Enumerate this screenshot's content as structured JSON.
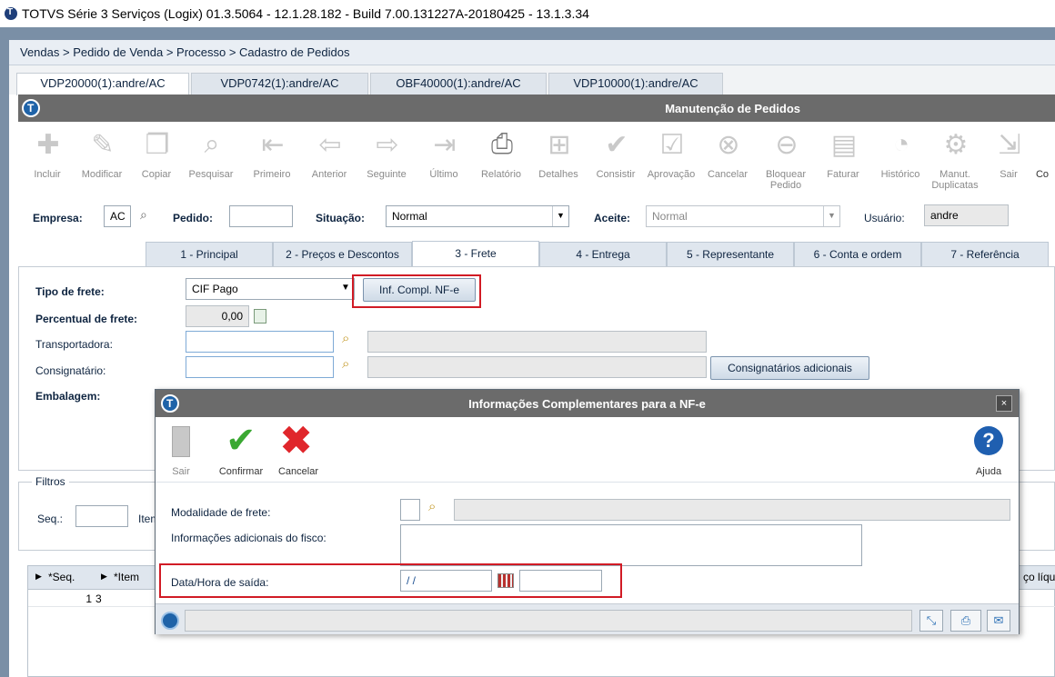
{
  "window": {
    "title": "TOTVS Série 3 Serviços (Logix) 01.3.5064  -  12.1.28.182 - Build 7.00.131227A-20180425 - 13.1.3.34"
  },
  "breadcrumb": "Vendas > Pedido de Venda > Processo > Cadastro de Pedidos",
  "main_tabs": [
    {
      "label": "VDP20000(1):andre/AC"
    },
    {
      "label": "VDP0742(1):andre/AC"
    },
    {
      "label": "OBF40000(1):andre/AC"
    },
    {
      "label": "VDP10000(1):andre/AC"
    }
  ],
  "app_title": "Manutenção de Pedidos",
  "toolbar": [
    {
      "label": "Incluir",
      "icon": "add-icon"
    },
    {
      "label": "Modificar",
      "icon": "edit-icon"
    },
    {
      "label": "Copiar",
      "icon": "copy-icon"
    },
    {
      "label": "Pesquisar",
      "icon": "search-icon"
    },
    {
      "label": "Primeiro",
      "icon": "first-icon"
    },
    {
      "label": "Anterior",
      "icon": "previous-icon"
    },
    {
      "label": "Seguinte",
      "icon": "next-icon"
    },
    {
      "label": "Último",
      "icon": "last-icon"
    },
    {
      "label": "Relatório",
      "icon": "print-icon"
    },
    {
      "label": "Detalhes",
      "icon": "details-icon"
    },
    {
      "label": "Consistir",
      "icon": "check-icon"
    },
    {
      "label": "Aprovação",
      "icon": "approval-icon"
    },
    {
      "label": "Cancelar",
      "icon": "cancel-icon"
    },
    {
      "label": "Bloquear Pedido",
      "icon": "block-icon"
    },
    {
      "label": "Faturar",
      "icon": "invoice-icon"
    },
    {
      "label": "Histórico",
      "icon": "history-icon"
    },
    {
      "label": "Manut. Duplicatas",
      "icon": "duplicates-icon"
    },
    {
      "label": "Sair",
      "icon": "exit-icon"
    },
    {
      "label": "Co",
      "icon": "more-icon"
    }
  ],
  "header": {
    "empresa_label": "Empresa:",
    "empresa_value": "AC",
    "pedido_label": "Pedido:",
    "pedido_value": "",
    "situacao_label": "Situação:",
    "situacao_value": "Normal",
    "aceite_label": "Aceite:",
    "aceite_value": "Normal",
    "usuario_label": "Usuário:",
    "usuario_value": "andre"
  },
  "sub_tabs": [
    {
      "label": "1 - Principal"
    },
    {
      "label": "2 - Preços e Descontos"
    },
    {
      "label": "3 - Frete"
    },
    {
      "label": "4 - Entrega"
    },
    {
      "label": "5 - Representante"
    },
    {
      "label": "6 - Conta e ordem"
    },
    {
      "label": "7 - Referência"
    }
  ],
  "frete": {
    "tipo_label": "Tipo de frete:",
    "tipo_value": "CIF Pago",
    "inf_button": "Inf. Compl. NF-e",
    "percentual_label": "Percentual de frete:",
    "percentual_value": "0,00",
    "transportadora_label": "Transportadora:",
    "consignatario_label": "Consignatário:",
    "consignatarios_button": "Consignatários adicionais",
    "embalagem_label": "Embalagem:"
  },
  "filtros": {
    "legend": "Filtros",
    "seq_label": "Seq.:",
    "item_label": "Item"
  },
  "grid": {
    "columns": [
      "*Seq.",
      "*Item",
      "ço líqu"
    ],
    "rows": [
      {
        "seq": "1",
        "item": "3"
      }
    ]
  },
  "dialog": {
    "title": "Informações Complementares para a NF-e",
    "close": "×",
    "toolbar": [
      {
        "label": "Sair",
        "icon": "exit-icon"
      },
      {
        "label": "Confirmar",
        "icon": "confirm-icon"
      },
      {
        "label": "Cancelar",
        "icon": "cancel-icon"
      },
      {
        "label": "Ajuda",
        "icon": "help-icon"
      }
    ],
    "modalidade_label": "Modalidade de frete:",
    "info_fisco_label": "Informações adicionais do fisco:",
    "data_hora_label": "Data/Hora de saída:",
    "data_value": " / /",
    "hora_value": ""
  },
  "colors": {
    "highlight": "#d11b25",
    "titlebar": "#6b6b6b",
    "confirm": "#3aa832",
    "cancel": "#e0262b",
    "help": "#1f5fb0"
  }
}
